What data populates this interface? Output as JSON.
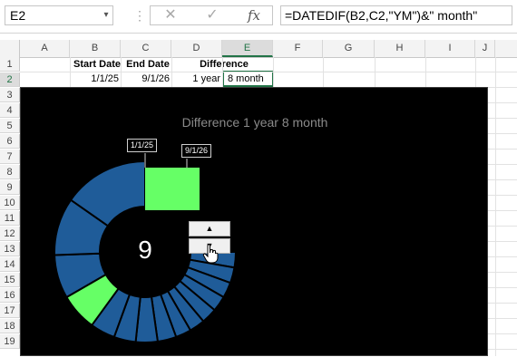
{
  "formula_bar": {
    "name_box": "E2",
    "name_box_arrow": "▾",
    "divider": "⋮",
    "cancel_icon": "✕",
    "enter_icon": "✓",
    "fx_label": "fx",
    "formula": "=DATEDIF(B2,C2,\"YM\")&\" month\""
  },
  "columns": [
    "A",
    "B",
    "C",
    "D",
    "E",
    "F",
    "G",
    "H",
    "I",
    "J"
  ],
  "active_column": "E",
  "rows": [
    "1",
    "2",
    "3",
    "4",
    "5",
    "6",
    "7",
    "8",
    "9",
    "10",
    "11",
    "12",
    "13",
    "14",
    "15",
    "16",
    "17",
    "18",
    "19"
  ],
  "active_row": "2",
  "table": {
    "headers": {
      "start": "Start Date",
      "end": "End Date",
      "diff": "Difference"
    },
    "values": {
      "start": "1/1/25",
      "end": "9/1/26",
      "years": "1 year",
      "months": "8 month"
    }
  },
  "chart": {
    "title": "Difference 1 year 8 month",
    "start_label": "1/1/25",
    "end_label": "9/1/26",
    "center_value": "9",
    "spinner_up": "▲",
    "spinner_down": "▼",
    "colors": {
      "background": "#000000",
      "segment": "#1f5c99",
      "highlight": "#66ff66",
      "title": "#8a8a8a"
    },
    "cursor_icon": "hand-pointer-icon"
  }
}
